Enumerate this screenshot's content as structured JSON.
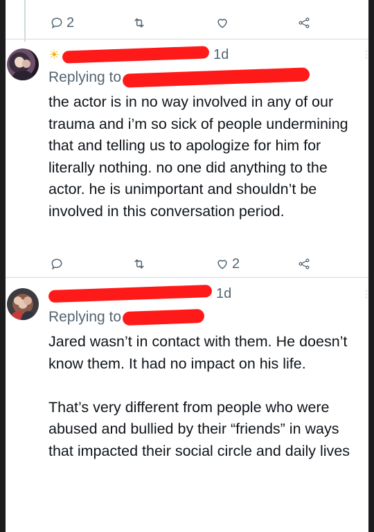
{
  "top_actions": {
    "reply_count": "2"
  },
  "tweet1": {
    "time": "1d",
    "replying_label": "Replying to",
    "text": "the actor is in no way involved in any of our trauma and i’m so sick of people undermining that and telling us to apologize for him for literally nothing. no one did anything to the actor. he is unimportant and shouldn’t be involved in this conversation period.",
    "like_count": "2"
  },
  "tweet2": {
    "time": "1d",
    "replying_label": "Replying to",
    "text": "Jared wasn’t in contact with them. He doesn’t know them. It had no impact on his life.\n\nThat’s very different from people who were abused and bullied by their “friends” in ways that impacted their social circle and daily lives"
  },
  "colors": {
    "redaction": "#ff1a1a",
    "text": "#0f1419",
    "muted": "#536471"
  }
}
